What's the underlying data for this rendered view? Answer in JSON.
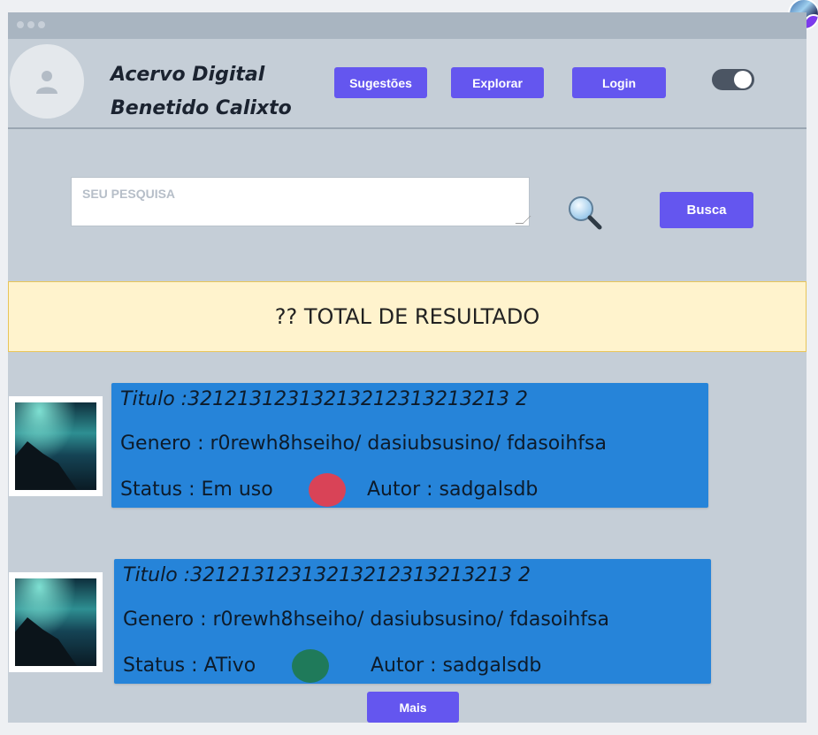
{
  "header": {
    "brand_line1": "Acervo Digital",
    "brand_line2": "Benetido Calixto",
    "nav": {
      "suggestions": "Sugestões",
      "explore": "Explorar",
      "login": "Login"
    }
  },
  "search": {
    "placeholder": "SEU PESQUISA",
    "button": "Busca"
  },
  "results_banner": "?? TOTAL DE RESULTADO",
  "results": [
    {
      "title": "Titulo :32121312313213212313213213 2",
      "genre": "Genero :  r0rewh8hseiho/ dasiubsusino/ fdasoihfsa",
      "status": "Status : Em uso",
      "status_color": "#d94357",
      "author": "Autor : sadgalsdb"
    },
    {
      "title": "Titulo :32121312313213212313213213 2",
      "genre": "Genero :  r0rewh8hseiho/ dasiubsusino/ fdasoihfsa",
      "status": "Status : ATivo",
      "status_color": "#1f7a5a",
      "author": "Autor : sadgalsdb"
    }
  ],
  "more_button": "Mais",
  "colors": {
    "accent": "#6456ef",
    "card": "#2684d9",
    "banner_bg": "#fff3cd"
  }
}
